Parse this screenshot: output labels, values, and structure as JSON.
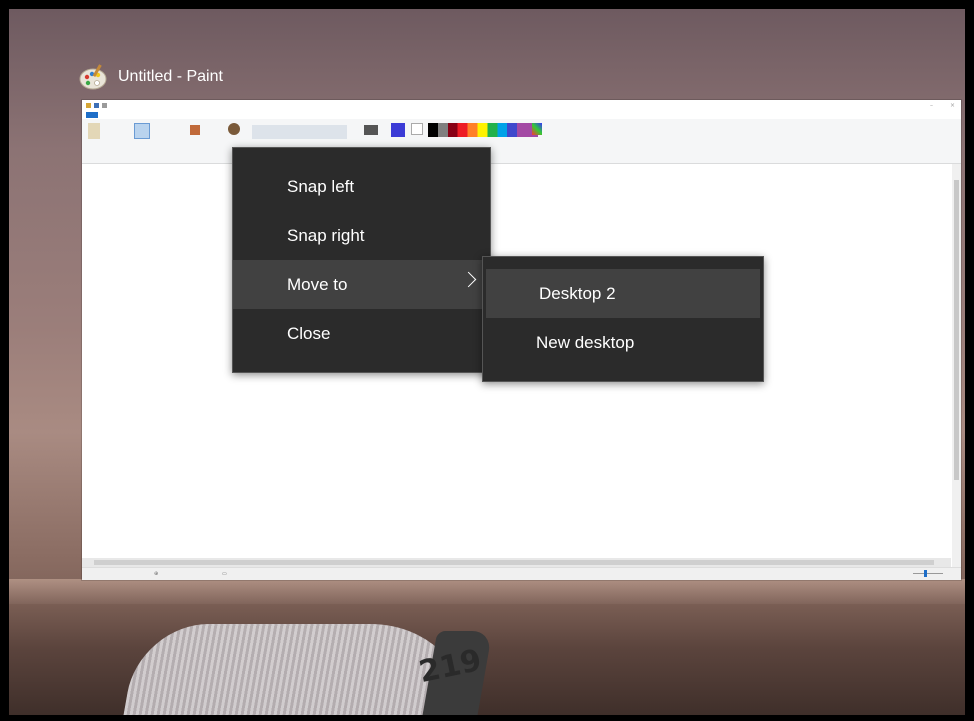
{
  "task_view": {
    "window_title": "Untitled - Paint",
    "app_icon": "paint-palette-icon"
  },
  "context_menu": {
    "items": [
      {
        "label": "Snap left"
      },
      {
        "label": "Snap right"
      },
      {
        "label": "Move to",
        "has_submenu": true,
        "highlighted": true
      },
      {
        "label": "Close"
      }
    ]
  },
  "submenu": {
    "items": [
      {
        "label": "Desktop 2",
        "highlighted": true
      },
      {
        "label": "New desktop"
      }
    ]
  },
  "wallpaper": {
    "chair_number": "219"
  },
  "colors": {
    "menu_bg": "#2b2b2b",
    "menu_highlight": "#414141",
    "menu_text": "#ffffff",
    "paint_file_tab": "#1e6ec8"
  }
}
